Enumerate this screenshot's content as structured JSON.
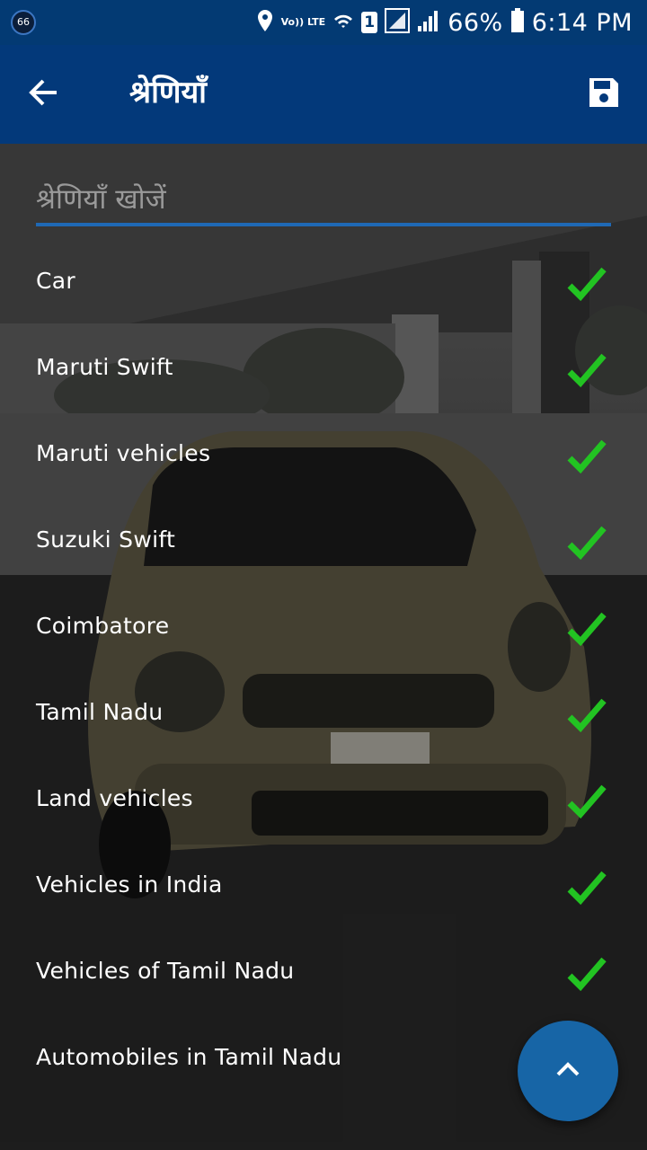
{
  "status_bar": {
    "notification_count": "66",
    "network": "Vo)) LTE",
    "sim_slot": "1",
    "battery": "66%",
    "time": "6:14 PM"
  },
  "toolbar": {
    "title": "श्रेणियाँ",
    "back_icon": "arrow-left-icon",
    "save_icon": "floppy-disk-icon"
  },
  "search": {
    "placeholder": "श्रेणियाँ खोजें",
    "value": ""
  },
  "categories": [
    {
      "label": "Car",
      "checked": true
    },
    {
      "label": "Maruti Swift",
      "checked": true
    },
    {
      "label": "Maruti vehicles",
      "checked": true
    },
    {
      "label": "Suzuki Swift",
      "checked": true
    },
    {
      "label": "Coimbatore",
      "checked": true
    },
    {
      "label": "Tamil Nadu",
      "checked": true
    },
    {
      "label": "Land vehicles",
      "checked": true
    },
    {
      "label": "Vehicles in India",
      "checked": true
    },
    {
      "label": "Vehicles of Tamil Nadu",
      "checked": true
    },
    {
      "label": "Automobiles in Tamil Nadu",
      "checked": false
    }
  ],
  "fab": {
    "icon": "chevron-up-icon"
  },
  "colors": {
    "status_bar": "#033a73",
    "toolbar": "#03397a",
    "accent_line": "#1f69b5",
    "check": "#22c322",
    "fab": "#1765a6"
  }
}
